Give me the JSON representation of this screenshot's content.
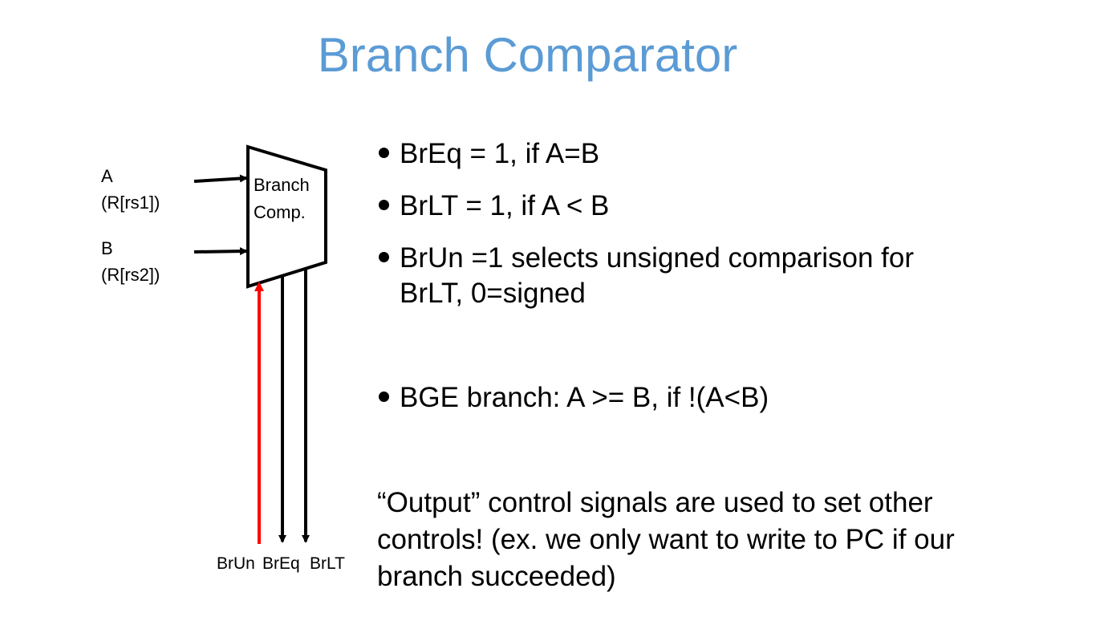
{
  "title": "Branch Comparator",
  "diagram": {
    "block_label_line1": "Branch",
    "block_label_line2": "Comp.",
    "input_a_name": "A",
    "input_a_source": "(R[rs1])",
    "input_b_name": "B",
    "input_b_source": "(R[rs2])",
    "signal_brun": "BrUn",
    "signal_breq": "BrEq",
    "signal_brlt": "BrLT",
    "colors": {
      "brun_arrow": "#ff0000",
      "wires": "#000000"
    }
  },
  "bullets": [
    "BrEq = 1, if A=B",
    "BrLT = 1, if A < B",
    "BrUn =1 selects unsigned comparison for BrLT, 0=signed",
    "BGE branch: A >= B, if  !(A<B)"
  ],
  "note": "“Output” control signals are used to set other controls! (ex. we only want to write to PC if our branch succeeded)"
}
